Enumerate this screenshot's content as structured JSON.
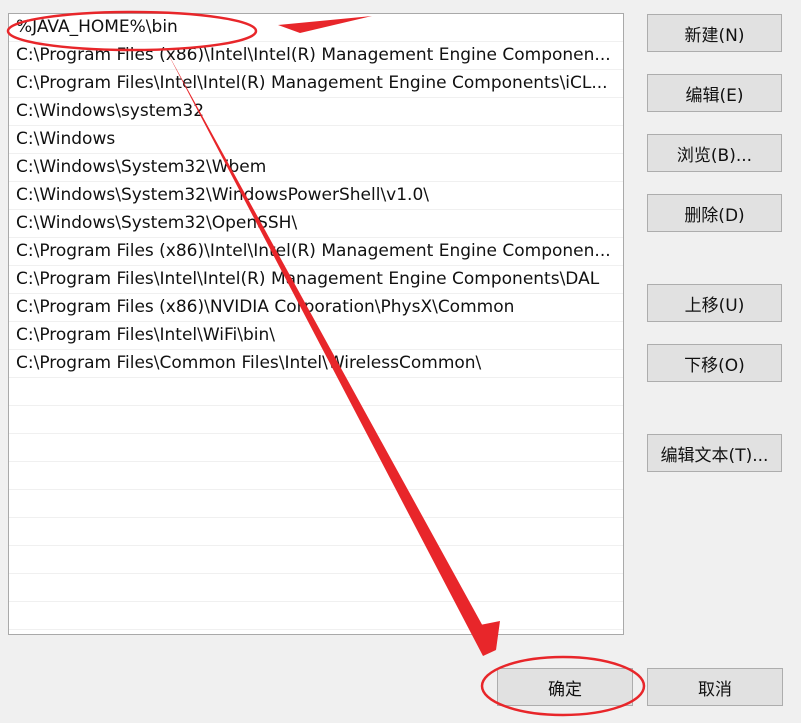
{
  "paths": [
    "%JAVA_HOME%\\bin",
    "C:\\Program Files (x86)\\Intel\\Intel(R) Management Engine Componen...",
    "C:\\Program Files\\Intel\\Intel(R) Management Engine Components\\iCL...",
    "C:\\Windows\\system32",
    "C:\\Windows",
    "C:\\Windows\\System32\\Wbem",
    "C:\\Windows\\System32\\WindowsPowerShell\\v1.0\\",
    "C:\\Windows\\System32\\OpenSSH\\",
    "C:\\Program Files (x86)\\Intel\\Intel(R) Management Engine Componen...",
    "C:\\Program Files\\Intel\\Intel(R) Management Engine Components\\DAL",
    "C:\\Program Files (x86)\\NVIDIA Corporation\\PhysX\\Common",
    "C:\\Program Files\\Intel\\WiFi\\bin\\",
    "C:\\Program Files\\Common Files\\Intel\\WirelessCommon\\"
  ],
  "buttons": {
    "new": "新建(N)",
    "edit": "编辑(E)",
    "browse": "浏览(B)...",
    "delete": "删除(D)",
    "move_up": "上移(U)",
    "move_down": "下移(O)",
    "edit_text": "编辑文本(T)...",
    "ok": "确定",
    "cancel": "取消"
  },
  "colors": {
    "annotation": "#e8262a",
    "button_bg": "#e1e1e1",
    "dialog_bg": "#f0f0f0"
  }
}
